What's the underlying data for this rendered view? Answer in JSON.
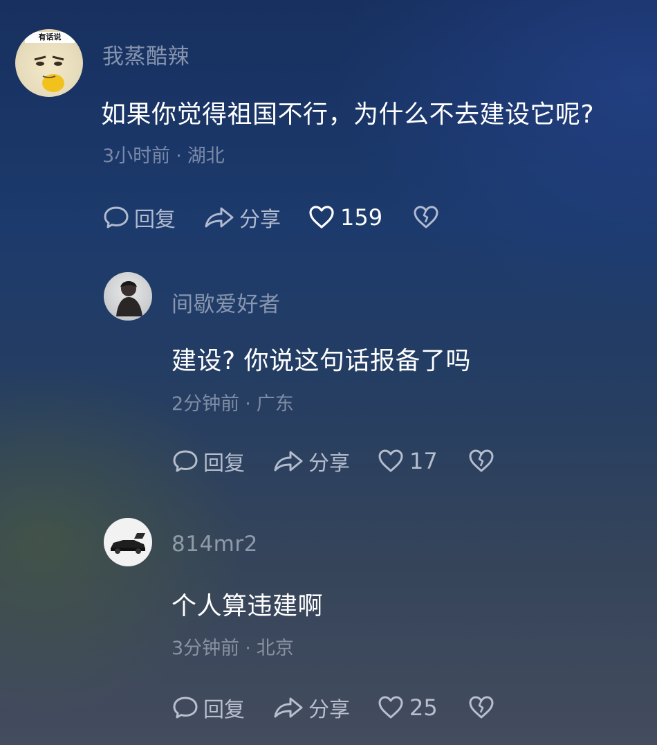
{
  "comments": [
    {
      "username": "我蒸酷辣",
      "avatar_badge": "有话说",
      "text": "如果你觉得祖国不行，为什么不去建设它呢?",
      "time": "3小时前",
      "location": "湖北",
      "reply_label": "回复",
      "share_label": "分享",
      "likes": "159"
    },
    {
      "username": "间歇爱好者",
      "text": "建设? 你说这句话报备了吗",
      "time": "2分钟前",
      "location": "广东",
      "reply_label": "回复",
      "share_label": "分享",
      "likes": "17"
    },
    {
      "username": "814mr2",
      "text": "个人算违建啊",
      "time": "3分钟前",
      "location": "北京",
      "reply_label": "回复",
      "share_label": "分享",
      "likes": "25"
    }
  ],
  "meta_separator": "·",
  "icons": {
    "reply": "reply-bubble-icon",
    "share": "share-arrow-icon",
    "like": "heart-icon",
    "dislike": "broken-heart-icon"
  }
}
